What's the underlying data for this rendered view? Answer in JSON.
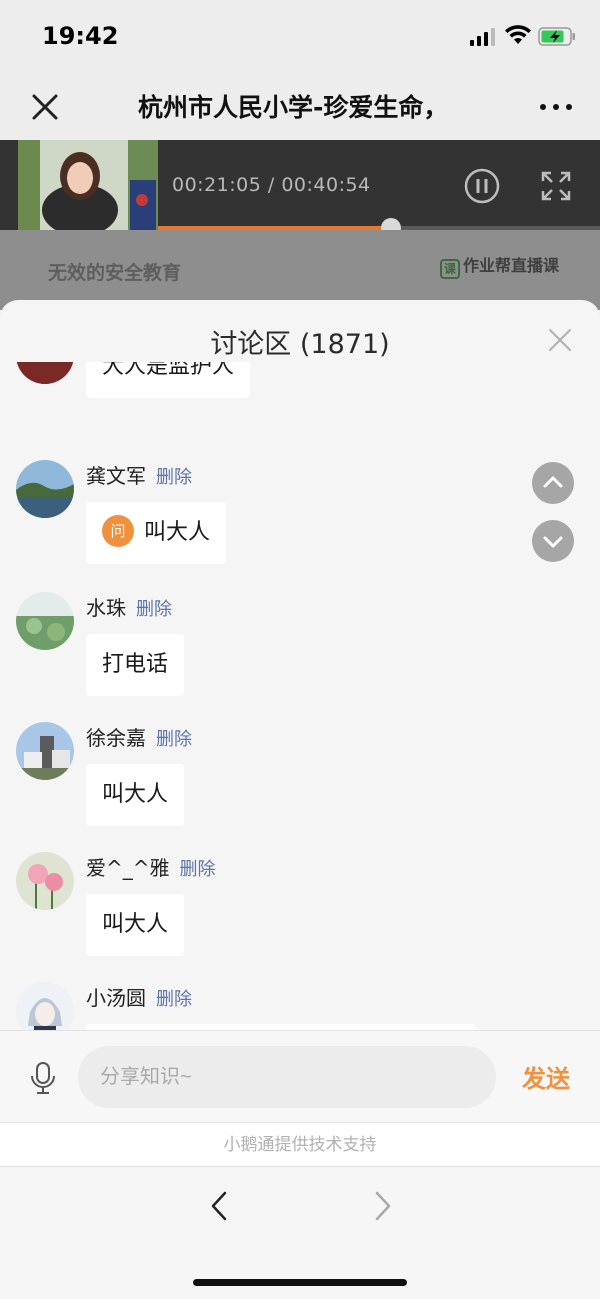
{
  "status_bar": {
    "time": "19:42"
  },
  "nav": {
    "title": "杭州市人民小学-珍爱生命，"
  },
  "video": {
    "time_display": "00:21:05 / 00:40:54",
    "progress": 0.53
  },
  "dim_area": {
    "caption": "无效的安全教育",
    "brand_icon": "课",
    "brand": "作业帮直播课"
  },
  "discussion": {
    "title": "讨论区 (1871)",
    "delete_label": "删除",
    "question_badge": "问",
    "messages": [
      {
        "name": "",
        "text": "大人是监护人"
      },
      {
        "name": "龚文军",
        "text": "叫大人",
        "is_question": true
      },
      {
        "name": "水珠",
        "text": "打电话"
      },
      {
        "name": "徐余嘉",
        "text": "叫大人"
      },
      {
        "name": "爱^_^雅",
        "text": "叫大人"
      },
      {
        "name": "小汤圆",
        "text": ""
      }
    ]
  },
  "input": {
    "placeholder": "分享知识~",
    "send_label": "发送"
  },
  "footer": {
    "support": "小鹅通提供技术支持"
  },
  "colors": {
    "accent": "#f0913e",
    "delete_link": "#5a73a8"
  }
}
